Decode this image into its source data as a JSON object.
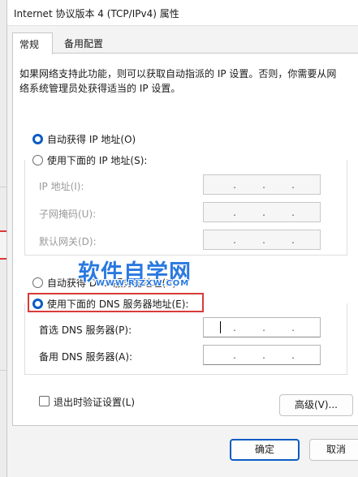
{
  "window": {
    "title": "Internet 协议版本 4 (TCP/IPv4) 属性"
  },
  "tabs": [
    {
      "label": "常规",
      "active": true
    },
    {
      "label": "备用配置",
      "active": false
    }
  ],
  "description": "如果网络支持此功能，则可以获取自动指派的 IP 设置。否则，你需要从网络系统管理员处获得适当的 IP 设置。",
  "ip_section": {
    "auto_option": {
      "label": "自动获得 IP 地址(O)",
      "checked": true
    },
    "manual_option": {
      "label": "使用下面的 IP 地址(S):",
      "checked": false
    },
    "fields": [
      {
        "label": "IP 地址(I):",
        "value": ". . ."
      },
      {
        "label": "子网掩码(U):",
        "value": ". . ."
      },
      {
        "label": "默认网关(D):",
        "value": ". . ."
      }
    ]
  },
  "dns_section": {
    "auto_option": {
      "label": "自动获得 DNS 服务器地址(B)",
      "checked": false
    },
    "manual_option": {
      "label": "使用下面的 DNS 服务器地址(E):",
      "checked": true
    },
    "fields": [
      {
        "label": "首选 DNS 服务器(P):",
        "value": ". . ."
      },
      {
        "label": "备用 DNS 服务器(A):",
        "value": ". . ."
      }
    ]
  },
  "validate_checkbox": {
    "label": "退出时验证设置(L)",
    "checked": false
  },
  "buttons": {
    "advanced": "高级(V)...",
    "ok": "确定",
    "cancel": "取消"
  },
  "watermark": {
    "main": "软件自学网",
    "sub": "WWW.RJZXW.COM"
  },
  "colors": {
    "accent": "#0a5cc2",
    "highlight": "#d93a3a",
    "watermark": "#2a79e0"
  }
}
